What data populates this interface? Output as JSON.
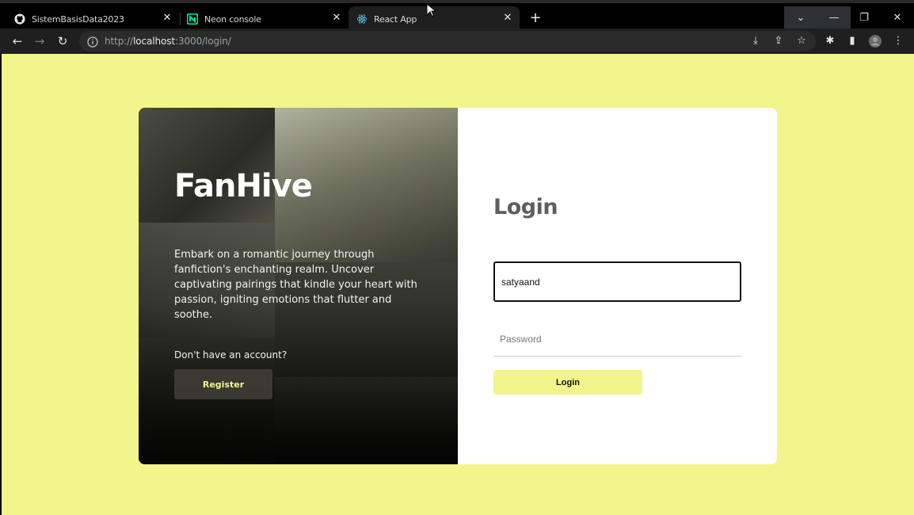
{
  "browser": {
    "tabs": [
      {
        "title": "SistemBasisData2023",
        "icon": "github-icon",
        "active": false
      },
      {
        "title": "Neon console",
        "icon": "neon-icon",
        "active": false
      },
      {
        "title": "React App",
        "icon": "react-icon",
        "active": true
      }
    ],
    "new_tab_label": "+",
    "url_prefix": "http://",
    "url_host": "localhost",
    "url_path": ":3000/login/"
  },
  "hero": {
    "brand": "FanHive",
    "tagline": "Embark on a romantic journey through fanfiction's enchanting realm. Uncover captivating pairings that kindle your heart with passion, igniting emotions that flutter and soothe.",
    "no_account": "Don't have an account?",
    "register_label": "Register"
  },
  "login": {
    "title": "Login",
    "username_value": "satyaand",
    "password_placeholder": "Password",
    "submit_label": "Login"
  },
  "colors": {
    "accent": "#f1f58c",
    "card_bg": "#ffffff",
    "title": "#5e5e5e"
  }
}
